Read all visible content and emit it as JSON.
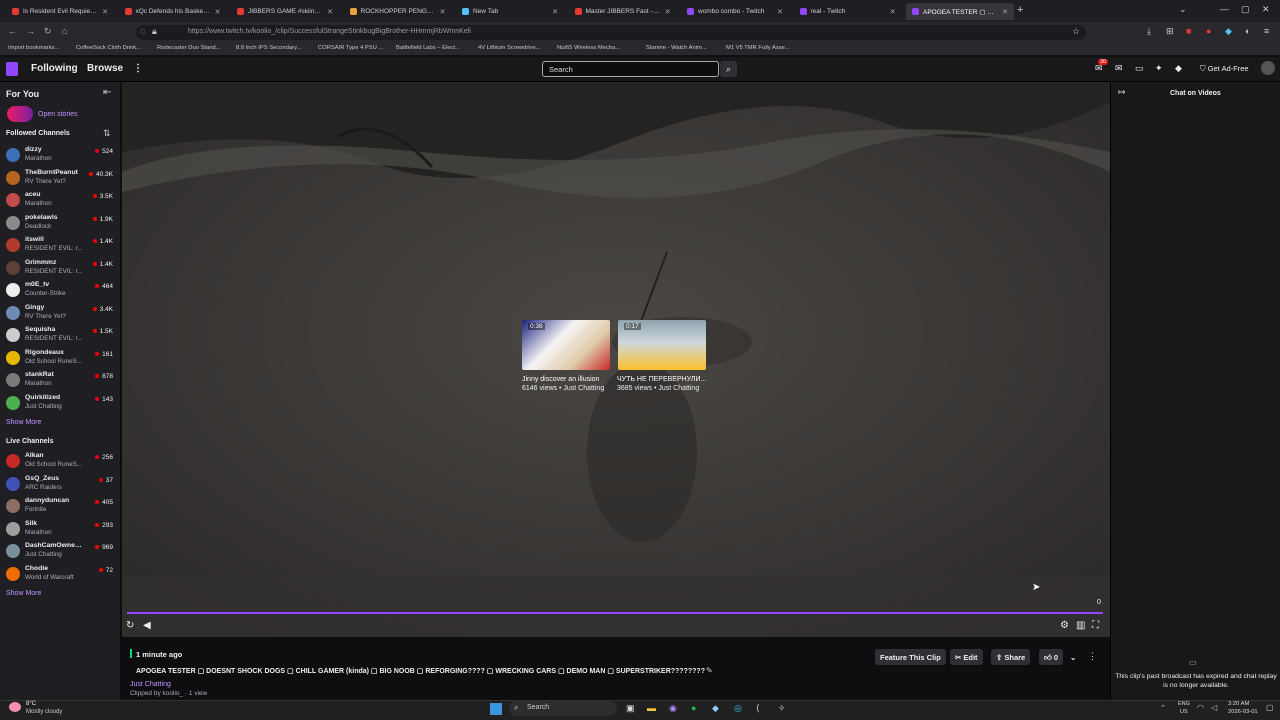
{
  "browser": {
    "tabs": [
      {
        "label": "Is Resident Evil Requiem Good",
        "color": "#e53935"
      },
      {
        "label": "xQc Defends his Basketball Skills",
        "color": "#e53935"
      },
      {
        "label": "JIBBERS GAME #skiing #bigair",
        "color": "#e53935"
      },
      {
        "label": "ROCKHOPPER PENGUIN at Dub",
        "color": "#e8a33d"
      },
      {
        "label": "New Tab",
        "color": "#4fc3f7"
      },
      {
        "label": "Master JIBBERS Fast - YouTube",
        "color": "#e53935"
      },
      {
        "label": "wombo combo - Twitch",
        "color": "#9147ff"
      },
      {
        "label": "real - Twitch",
        "color": "#9147ff"
      },
      {
        "label": "APOGEA TESTER ▢ DOESNT S",
        "color": "#9147ff"
      }
    ],
    "tab_close": "✕",
    "new_tab": "+",
    "url": "https://www.twitch.tv/koolio_/clip/SuccessfulStrangeStinkbugBigBrother-HHmmjRbWmnKeli",
    "bookmarks": [
      "Import bookmarks...",
      "CoffeeSock Cloth Drink...",
      "Rodecaster Duo Stand...",
      "8.8 Inch IPS Secondary...",
      "CORSAIR Type 4 PSU ...",
      "Battlefield Labs – Elect...",
      "4V Lithium Screwdrive...",
      "Nut65 Wireless Mecha...",
      "Stanme - Watch Anim...",
      "M1 V5 TMR Fully Asse..."
    ]
  },
  "twitch": {
    "nav": {
      "following": "Following",
      "browse": "Browse",
      "more": "⋮",
      "search_placeholder": "Search",
      "notif_count": "30",
      "ad_free": "Get Ad-Free"
    },
    "sidebar": {
      "for_you": "For You",
      "open_stories": "Open stories",
      "followed_title": "Followed Channels",
      "followed": [
        {
          "name": "dizzy",
          "game": "Marathon",
          "viewers": "524",
          "color": "#3b6fb6"
        },
        {
          "name": "TheBurntPeanut",
          "game": "RV There Yet?",
          "viewers": "40.3K",
          "color": "#b5651d"
        },
        {
          "name": "aceu",
          "game": "Marathon",
          "viewers": "3.5K",
          "color": "#c14a4a"
        },
        {
          "name": "pokelawls",
          "game": "Deadlock",
          "viewers": "1.9K",
          "color": "#8a8a8a"
        },
        {
          "name": "itswill",
          "game": "RESIDENT EVIL: r...",
          "viewers": "1.4K",
          "color": "#b03a2e"
        },
        {
          "name": "Grimmmz",
          "game": "RESIDENT EVIL: r...",
          "viewers": "1.4K",
          "color": "#5d4037"
        },
        {
          "name": "m0E_tv",
          "game": "Counter-Strike",
          "viewers": "464",
          "color": "#eeeeee"
        },
        {
          "name": "Gingy",
          "game": "RV There Yet?",
          "viewers": "3.4K",
          "color": "#6d8bb5"
        },
        {
          "name": "Sequisha",
          "game": "RESIDENT EVIL: r...",
          "viewers": "1.5K",
          "color": "#cccccc"
        },
        {
          "name": "Rigondeaux",
          "game": "Old School RuneS...",
          "viewers": "161",
          "color": "#e6b800"
        },
        {
          "name": "stankRat",
          "game": "Marathon",
          "viewers": "878",
          "color": "#7a7a7a"
        },
        {
          "name": "Quirkitized",
          "game": "Just Chatting",
          "viewers": "143",
          "color": "#4caf50"
        }
      ],
      "show_more_1": "Show More",
      "live_title": "Live Channels",
      "live": [
        {
          "name": "Alkan",
          "game": "Old School RuneS...",
          "viewers": "256",
          "color": "#c62828"
        },
        {
          "name": "GsQ_Zeus",
          "game": "ARC Raiders",
          "viewers": "37",
          "color": "#3f51b5"
        },
        {
          "name": "dannyduncan",
          "game": "Fortnite",
          "viewers": "405",
          "color": "#8d6e63"
        },
        {
          "name": "Silk",
          "game": "Marathon",
          "viewers": "293",
          "color": "#9e9e9e"
        },
        {
          "name": "DashCamOwners...",
          "game": "Just Chatting",
          "viewers": "969",
          "color": "#78909c"
        },
        {
          "name": "Chodie",
          "game": "World of Warcraft",
          "viewers": "72",
          "color": "#ef6c00"
        }
      ],
      "show_more_2": "Show More"
    },
    "player": {
      "clips": [
        {
          "duration": "0:38",
          "title": "Jinny discover an illusion",
          "meta": "6146 views • Just Chatting"
        },
        {
          "duration": "0:17",
          "title": "ЧУТЬ НЕ ПЕРЕВЕРНУЛИ...",
          "meta": "3685 views • Just Chatting"
        }
      ],
      "time_right": "0"
    },
    "clip_info": {
      "age": "1 minute ago",
      "title": "APOGEA TESTER ▢ DOESNT SHOCK DOGS ▢ CHILL GAMER (kinda) ▢ BIG NOOB ▢ REFORGING???? ▢ WRECKING CARS ▢ DEMO MAN ▢ SUPERSTRIKER????????",
      "category": "Just Chatting",
      "clipped_by": "Clipped by koolio_ · 1 view",
      "feature": "Feature This Clip",
      "edit": "Edit",
      "share": "Share",
      "likes": "0"
    },
    "chat": {
      "header": "Chat on Videos",
      "expired": "This clip's past broadcast has expired and chat replay is no longer available."
    }
  },
  "taskbar": {
    "temp": "8°C",
    "weather": "Mostly cloudy",
    "search": "Search",
    "lang": "ENG",
    "region": "US",
    "time": "3:20 AM",
    "date": "2026-03-01"
  }
}
